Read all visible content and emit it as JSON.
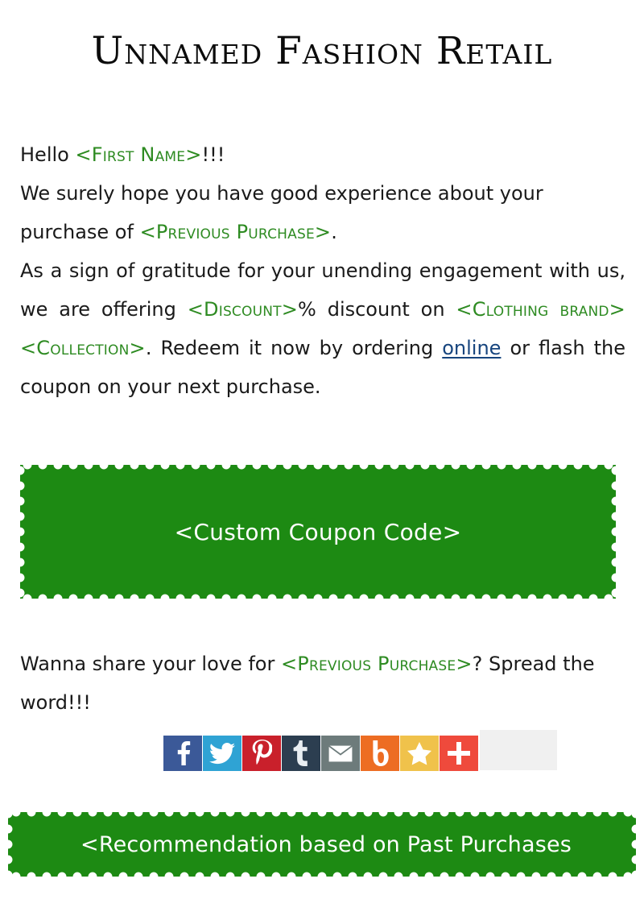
{
  "header": {
    "title": "Unnamed Fashion Retail"
  },
  "colors": {
    "placeholder_green": "#2e8b22",
    "stamp_green": "#1d8a13",
    "link_blue": "#17457e",
    "body_text": "#1a1a1a",
    "empty_box_gray": "#f0f0f0"
  },
  "greeting": {
    "prefix": "Hello ",
    "placeholder": "<First Name>",
    "suffix": "!!!"
  },
  "paragraph1": {
    "part1": "We surely hope you have good experience about your purchase of ",
    "placeholder1": "<Previous Purchase>",
    "part2": "."
  },
  "paragraph2": {
    "part1": "As a sign of gratitude for your unending engagement with us, we are offering ",
    "placeholder_discount": "<Discount>",
    "part2": "% discount on ",
    "placeholder_brand": "<Clothing brand>",
    "part3": " ",
    "placeholder_collection": "<Collection>",
    "part4": ". Redeem it now by ordering ",
    "link_label": "online",
    "part5": " or flash the coupon on your next purchase."
  },
  "coupon": {
    "code_label": "<Custom Coupon Code>"
  },
  "share": {
    "part1": "Wanna share your love for ",
    "placeholder": "<Previous Purchase>",
    "part2": "? Spread the word!!!"
  },
  "social": {
    "items": [
      {
        "name": "facebook",
        "label": "Facebook",
        "glyph": "f",
        "color": "#3b5998"
      },
      {
        "name": "twitter",
        "label": "Twitter",
        "glyph": "bird",
        "color": "#2fa3d4"
      },
      {
        "name": "pinterest",
        "label": "Pinterest",
        "glyph": "p",
        "color": "#c9202b"
      },
      {
        "name": "tumblr",
        "label": "Tumblr",
        "glyph": "t",
        "color": "#2c3e50"
      },
      {
        "name": "email",
        "label": "Email",
        "glyph": "envelope",
        "color": "#6d7b7b"
      },
      {
        "name": "blogger",
        "label": "Blogger",
        "glyph": "b",
        "color": "#ed6d23"
      },
      {
        "name": "favorites",
        "label": "Favorites",
        "glyph": "star",
        "color": "#f0c24b"
      },
      {
        "name": "addthis",
        "label": "AddThis",
        "glyph": "plus",
        "color": "#ef4a3c"
      }
    ]
  },
  "recommendation": {
    "label": "<Recommendation based on Past Purchases"
  }
}
